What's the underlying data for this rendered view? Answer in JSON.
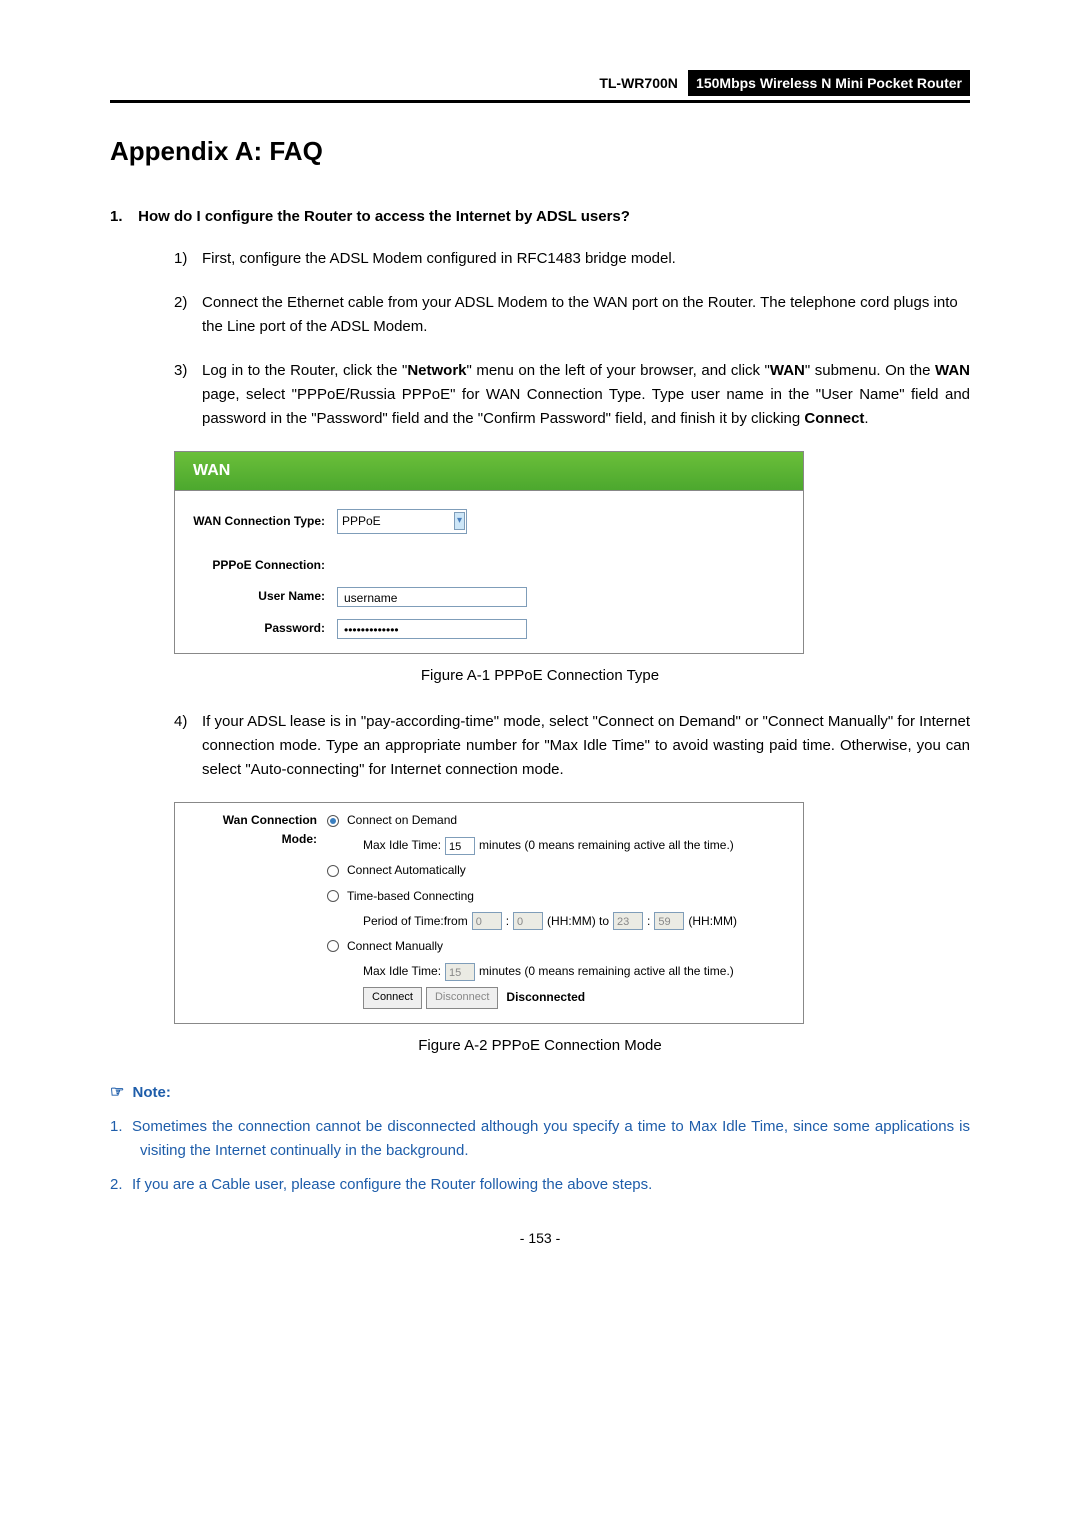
{
  "header": {
    "model": "TL-WR700N",
    "product": "150Mbps Wireless N Mini Pocket Router"
  },
  "title": "Appendix A: FAQ",
  "q1": {
    "num": "1.",
    "text": "How do I configure the Router to access the Internet by ADSL users?"
  },
  "steps": {
    "s1_num": "1)",
    "s1": "First, configure the ADSL Modem configured in RFC1483 bridge model.",
    "s2_num": "2)",
    "s2": "Connect the Ethernet cable from your ADSL Modem to the WAN port on the Router. The telephone cord plugs into the Line port of the ADSL Modem.",
    "s3_num": "3)",
    "s3_a": "Log in to the Router, click the \"",
    "s3_b": "Network",
    "s3_c": "\" menu on the left of your browser, and click \"",
    "s3_d": "WAN",
    "s3_e": "\" submenu. On the ",
    "s3_f": "WAN",
    "s3_g": " page, select \"PPPoE/Russia PPPoE\" for WAN Connection Type. Type user name in the \"User Name\" field and password in the \"Password\" field and the \"Confirm Password\" field, and finish it by clicking ",
    "s3_h": "Connect",
    "s3_i": ".",
    "s4_num": "4)",
    "s4": "If your ADSL lease is in \"pay-according-time\" mode, select \"Connect on Demand\" or \"Connect Manually\" for Internet connection mode. Type an appropriate number for \"Max Idle Time\" to avoid wasting paid time. Otherwise, you can select \"Auto-connecting\" for Internet connection mode."
  },
  "wan_panel": {
    "header": "WAN",
    "conn_type_label": "WAN Connection Type:",
    "conn_type_value": "PPPoE",
    "pppoe_label": "PPPoE Connection:",
    "username_label": "User Name:",
    "username_value": "username",
    "password_label": "Password:",
    "password_value": "•••••••••••••"
  },
  "fig_a1": "Figure A-1 PPPoE Connection Type",
  "mode_panel": {
    "mode_label": "Wan Connection Mode:",
    "opt1": "Connect on Demand",
    "max_idle_label": "Max Idle Time:",
    "max_idle_val1": "15",
    "max_idle_suffix": "minutes (0 means remaining active all the time.)",
    "opt2": "Connect Automatically",
    "opt3": "Time-based Connecting",
    "period_label": "Period of Time:from",
    "from_hh": "0",
    "from_mm": "0",
    "hhmm_to": "(HH:MM) to",
    "to_hh": "23",
    "to_mm": "59",
    "hhmm": "(HH:MM)",
    "opt4": "Connect Manually",
    "max_idle_val2": "15",
    "connect_btn": "Connect",
    "disconnect_btn": "Disconnect",
    "status": "Disconnected"
  },
  "fig_a2": "Figure A-2   PPPoE Connection Mode",
  "note": {
    "header": "Note:",
    "n1_num": "1.",
    "n1": "Sometimes the connection cannot be disconnected although you specify a time to Max Idle Time, since some applications is visiting the Internet continually in the background.",
    "n2_num": "2.",
    "n2": "If you are a Cable user, please configure the Router following the above steps."
  },
  "page_num": "- 153 -"
}
